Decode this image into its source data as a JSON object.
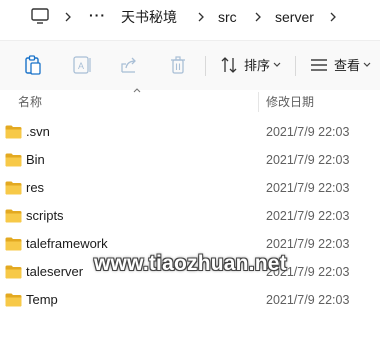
{
  "breadcrumb": {
    "items": [
      "天书秘境",
      "src",
      "server"
    ]
  },
  "toolbar": {
    "sort_label": "排序",
    "view_label": "查看"
  },
  "columns": {
    "name": "名称",
    "modified": "修改日期"
  },
  "files": [
    {
      "name": ".svn",
      "modified": "2021/7/9 22:03"
    },
    {
      "name": "Bin",
      "modified": "2021/7/9 22:03"
    },
    {
      "name": "res",
      "modified": "2021/7/9 22:03"
    },
    {
      "name": "scripts",
      "modified": "2021/7/9 22:03"
    },
    {
      "name": "taleframework",
      "modified": "2021/7/9 22:03"
    },
    {
      "name": "taleserver",
      "modified": "2021/7/9 22:03"
    },
    {
      "name": "Temp",
      "modified": "2021/7/9 22:03"
    }
  ],
  "watermark": "www.tiaozhuan.net",
  "colors": {
    "folder": "#f7c948",
    "folder_dark": "#e3a921",
    "accent": "#0067c0"
  }
}
